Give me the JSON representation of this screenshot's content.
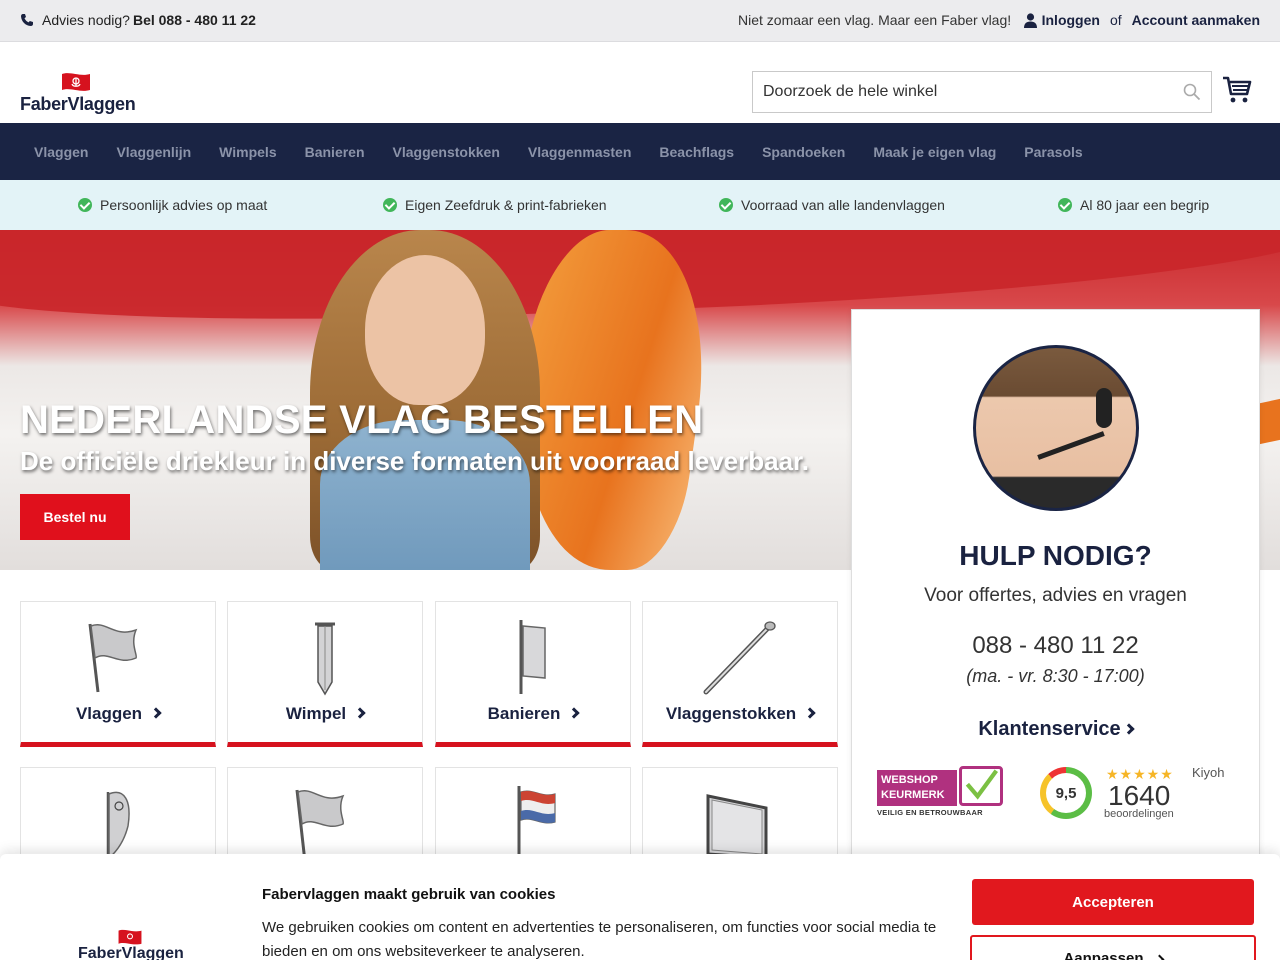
{
  "topbar": {
    "advice_prefix": "Advies nodig?",
    "advice_phone": "Bel 088 - 480 11 22",
    "slogan": "Niet zomaar een vlag. Maar een Faber vlag!",
    "login": "Inloggen",
    "or": "of",
    "create_account": "Account aanmaken"
  },
  "header": {
    "logo_text": "FaberVlaggen",
    "search_placeholder": "Doorzoek de hele winkel"
  },
  "nav": {
    "items": [
      "Vlaggen",
      "Vlaggenlijn",
      "Wimpels",
      "Banieren",
      "Vlaggenstokken",
      "Vlaggenmasten",
      "Beachflags",
      "Spandoeken",
      "Maak je eigen vlag",
      "Parasols"
    ]
  },
  "usp": {
    "items": [
      "Persoonlijk advies op maat",
      "Eigen Zeefdruk & print-fabrieken",
      "Voorraad van alle landenvlaggen",
      "Al 80 jaar een begrip"
    ]
  },
  "hero": {
    "title": "NEDERLANDSE VLAG BESTELLEN",
    "subtitle": "De officiële driekleur in diverse formaten uit voorraad leverbaar.",
    "button": "Bestel nu"
  },
  "help": {
    "title": "HULP NODIG?",
    "subtitle": "Voor offertes, advies en vragen",
    "phone": "088 - 480 11 22",
    "hours": "(ma. - vr. 8:30 - 17:00)",
    "service_link": "Klantenservice",
    "keurmerk_line1": "WEBSHOP",
    "keurmerk_line2": "KEURMERK",
    "keurmerk_small": "VEILIG EN BETROUWBAAR",
    "score": "9,5",
    "stars": "★★★★★",
    "review_count": "1640",
    "review_label": "beoordelingen",
    "kiyoh": "Kiyoh"
  },
  "categories": {
    "row1": [
      {
        "label": "Vlaggen",
        "icon": "flag-icon"
      },
      {
        "label": "Wimpel",
        "icon": "pennant-icon"
      },
      {
        "label": "Banieren",
        "icon": "banner-icon"
      },
      {
        "label": "Vlaggenstokken",
        "icon": "flagstick-icon"
      }
    ],
    "row2": [
      {
        "icon": "beachflag-icon"
      },
      {
        "icon": "flag-icon"
      },
      {
        "icon": "flagpole-icon"
      },
      {
        "icon": "frame-banner-icon"
      }
    ]
  },
  "cookie": {
    "logo_text": "FaberVlaggen",
    "title": "Fabervlaggen maakt gebruik van cookies",
    "text": "We gebruiken cookies om content en advertenties te personaliseren, om functies voor social media te bieden en om ons websiteverkeer te analyseren.",
    "accept": "Accepteren",
    "adjust": "Aanpassen"
  },
  "colors": {
    "navy": "#1a2444",
    "red": "#e0101c",
    "usp_bg": "#e3f3f7",
    "check_green": "#41b65a"
  }
}
